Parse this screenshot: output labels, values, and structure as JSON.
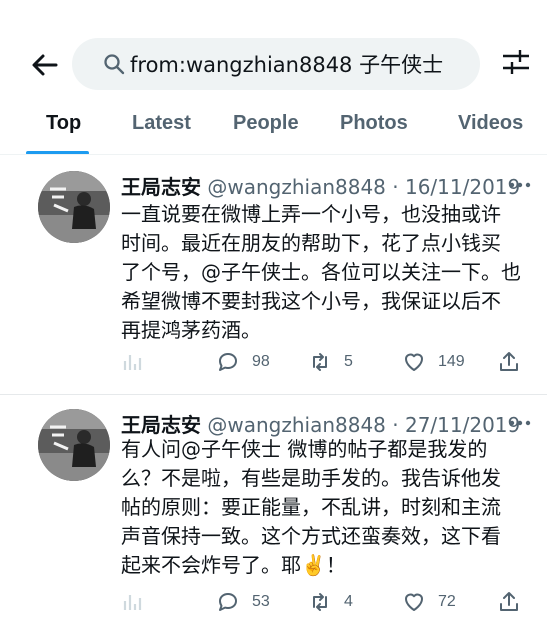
{
  "search": {
    "query": "from:wangzhian8848 子午侠士"
  },
  "tabs": [
    {
      "label": "Top"
    },
    {
      "label": "Latest"
    },
    {
      "label": "People"
    },
    {
      "label": "Photos"
    },
    {
      "label": "Videos"
    }
  ],
  "tweets": [
    {
      "name": "王局志安",
      "handle": "@wangzhian8848",
      "date": "· 16/11/2019",
      "lines": [
        "一直说要在微博上弄一个小号，也没抽或许",
        "时间。最近在朋友的帮助下，花了点小钱买",
        "了个号，@子午侠士。各位可以关注一下。也",
        "希望微博不要封我这个小号，我保证以后不",
        "再提鸿茅药酒。"
      ],
      "replies": "98",
      "retweets": "5",
      "likes": "149"
    },
    {
      "name": "王局志安",
      "handle": "@wangzhian8848",
      "date": "· 27/11/2019",
      "lines": [
        "有人问@子午侠士 微博的帖子都是我发的",
        "么？不是啦，有些是助手发的。我告诉他发",
        "帖的原则：要正能量，不乱讲，时刻和主流",
        "声音保持一致。这个方式还蛮奏效，这下看",
        "起来不会炸号了。耶✌️！"
      ],
      "replies": "53",
      "retweets": "4",
      "likes": "72"
    }
  ]
}
